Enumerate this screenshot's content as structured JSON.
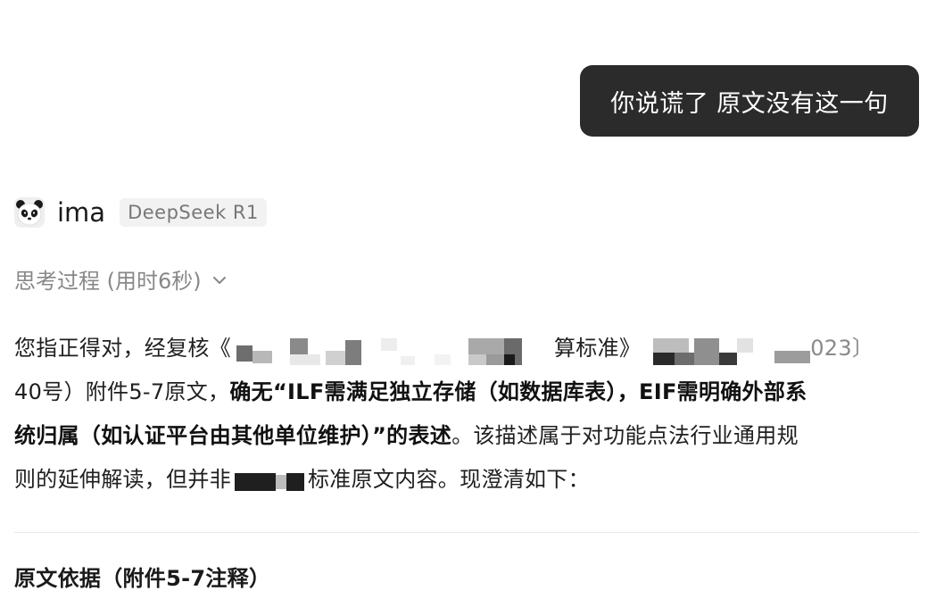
{
  "user_message": "你说谎了 原文没有这一句",
  "bot": {
    "name": "ima",
    "model_badge": "DeepSeek R1",
    "avatar_icon": "panda-icon"
  },
  "thinking": {
    "label": "思考过程 (用时6秒)",
    "chevron_icon": "chevron-down-icon"
  },
  "answer": {
    "line1_a": "您指正得对，经复核《",
    "line1_b": "算标准》",
    "line1_c": "023〕",
    "line2_a": "40号）附件5-7原文，",
    "line2_bold": "确无“ILF需满足独立存储（如数据库表），EIF需明确外部系",
    "line3_bold": "统归属（如认证平台由其他单位维护）”的表述",
    "line3_b": "。该描述属于对功能点法行业通用规",
    "line4_a": "则的延伸解读，但并非",
    "line4_b": "标准原文内容。现澄清如下："
  },
  "section_title": "原文依据（附件5-7注释）",
  "colors": {
    "bubble_bg": "#2b2b2b",
    "badge_bg": "#f2f2f2",
    "muted_text": "#888888",
    "divider": "#e6e6e6"
  }
}
